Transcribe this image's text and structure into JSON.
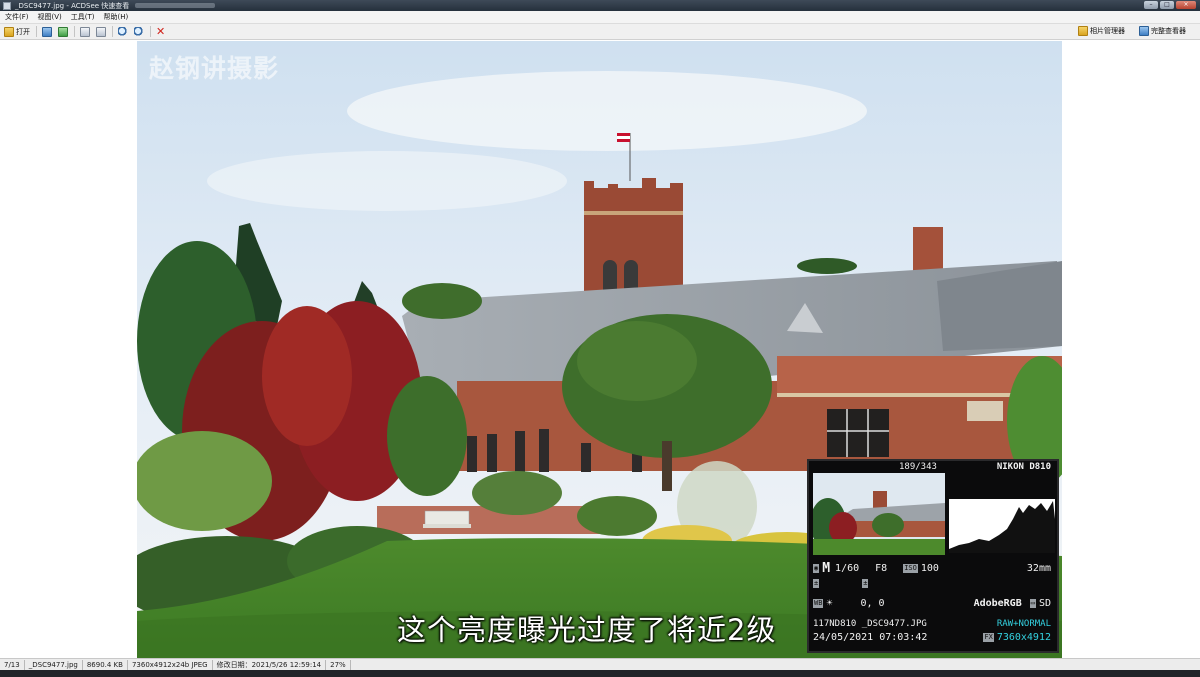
{
  "window": {
    "title": "_DSC9477.jpg - ACDSee 快速查看",
    "controls": [
      "–",
      "□",
      "×"
    ]
  },
  "menu": [
    "文件(F)",
    "视图(V)",
    "工具(T)",
    "帮助(H)"
  ],
  "toolbar": {
    "open_label": "打开",
    "photo_manager_label": "相片管理器",
    "full_viewer_label": "完整查看器"
  },
  "photo": {
    "watermark": "赵钢讲摄影",
    "subtitle": "这个亮度曝光过度了将近2级"
  },
  "camera_info": {
    "frame_counter": "189/343",
    "camera_model": "NIKON D810",
    "mode": "M",
    "shutter": "1/60",
    "aperture": "F8",
    "iso_label": "ISO",
    "iso": "100",
    "focal_length": "32mm",
    "wb_values": "0, 0",
    "color_space": "AdobeRGB",
    "card": "SD",
    "folder_file": "117ND810  _DSC9477.JPG",
    "quality": "RAW+NORMAL",
    "datetime": "24/05/2021  07:03:42",
    "fx_label": "FX",
    "resolution": "7360x4912"
  },
  "status": {
    "index": "7/13",
    "filename": "_DSC9477.jpg",
    "filesize": "8690.4 KB",
    "dimensions": "7360x4912x24b JPEG",
    "modified": "修改日期：2021/5/26 12:59:14",
    "zoom": "27%"
  }
}
